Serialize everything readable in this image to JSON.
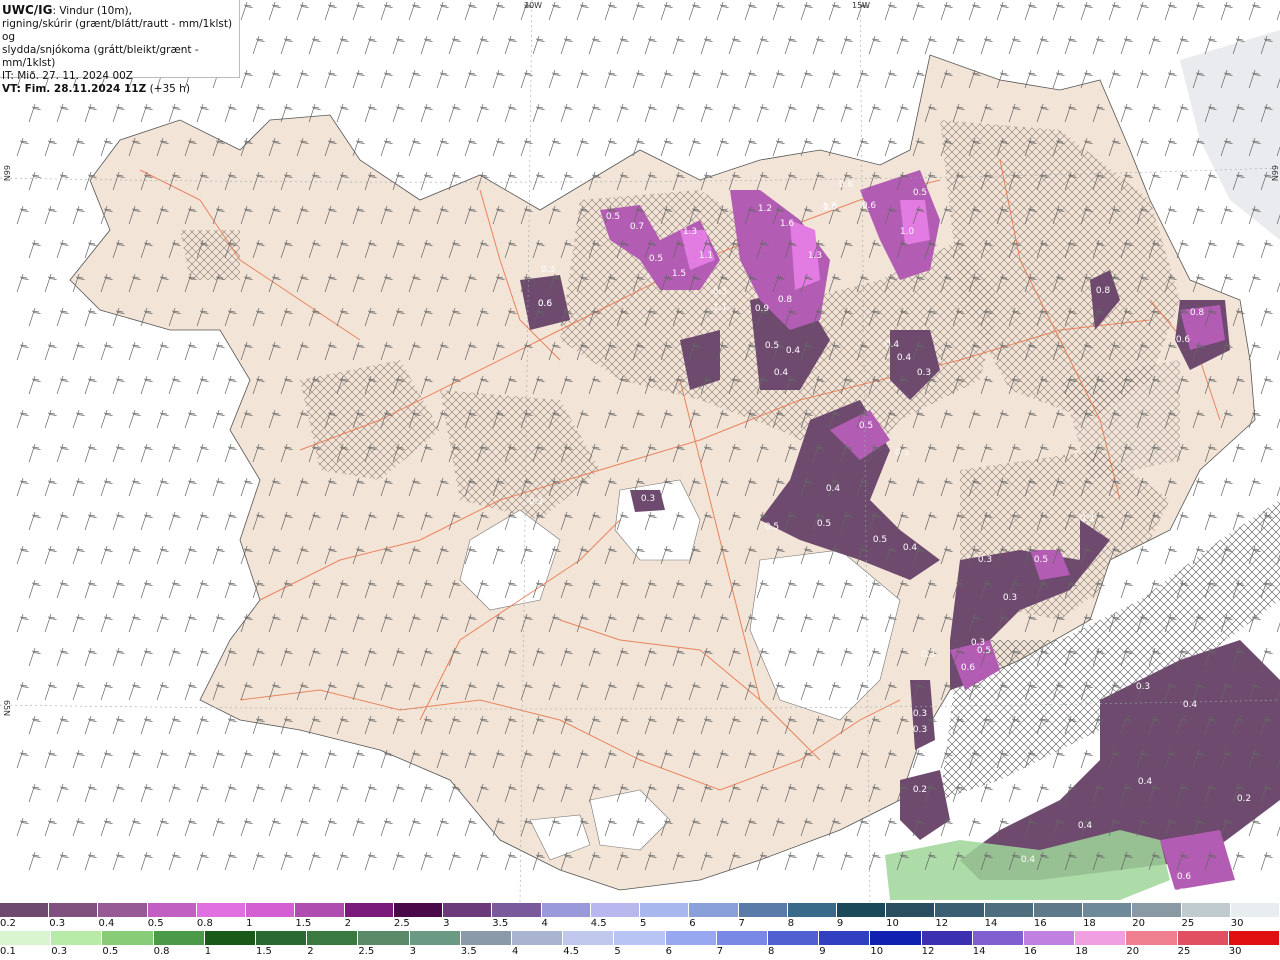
{
  "header": {
    "model": "UWC/IG",
    "line1_rest": ": Vindur (10m),",
    "line2": "rigning/skúrir (grænt/blátt/rautt - mm/1klst) og",
    "line3": "slydda/snjókoma (grátt/bleikt/grænt - mm/1klst)",
    "line4": "IT: Mið. 27. 11. 2024 00Z",
    "line5_bold": "VT: Fim. 28.11.2024 11Z",
    "line5_rest": " (+35 h)"
  },
  "axes": {
    "lon_labels": [
      "20W",
      "15W"
    ],
    "lat_labels": [
      "66N",
      "65N",
      "64N"
    ]
  },
  "map_labels": [
    "0.3",
    "0.6",
    "0.5",
    "0.7",
    "0.5",
    "1.3",
    "1.5",
    "1.1",
    "0.3",
    "1.1",
    "1.2",
    "0.9",
    "1.3",
    "1.6",
    "1.3",
    "0.8",
    "0.9",
    "0.5",
    "0.4",
    "0.4",
    "0.6",
    "0.6",
    "0.6",
    "0.5",
    "1.0",
    "0.4",
    "0.4",
    "0.3",
    "0.8",
    "0.8",
    "0.6",
    "0.5",
    "0.3",
    "0.3",
    "0.3",
    "0.4",
    "0.5",
    "0.5",
    "0.5",
    "0.4",
    "0.3",
    "0.3",
    "0.5",
    "0.3",
    "0.3",
    "0.5",
    "0.6",
    "0.3",
    "0.3",
    "0.3",
    "0.2",
    "0.2",
    "0.3",
    "0.4",
    "0.4",
    "0.2",
    "0.4",
    "0.4",
    "0.4",
    "0.6",
    "0.5",
    "0.6"
  ],
  "legend": {
    "snow_labels": [
      "0.2",
      "0.3",
      "0.4",
      "0.5",
      "0.8",
      "1",
      "1.5",
      "2",
      "2.5",
      "3",
      "3.5",
      "4",
      "4.5",
      "5",
      "6",
      "7",
      "8",
      "9",
      "10",
      "12",
      "14",
      "16",
      "18",
      "20",
      "25",
      "30"
    ],
    "snow_colors": [
      "#6e4a6e",
      "#80507f",
      "#975a97",
      "#c25fc2",
      "#e070e0",
      "#d35fd3",
      "#b04db0",
      "#7a1a7a",
      "#4a0a4a",
      "#6a3a7a",
      "#7a5a9a",
      "#9a9ada",
      "#b8b8ee",
      "#a8b8ee",
      "#8aa0d8",
      "#5a7aa8",
      "#3a6a8a",
      "#1a4a5a",
      "#284e60",
      "#3a5e72",
      "#4e6e80",
      "#5e7a8a",
      "#6e8a98",
      "#8a9aa4",
      "#c0cbd0",
      "#e8eef0"
    ],
    "rain_labels": [
      "0.1",
      "0.3",
      "0.5",
      "0.8",
      "1",
      "1.5",
      "2",
      "2.5",
      "3",
      "3.5",
      "4",
      "4.5",
      "5",
      "6",
      "7",
      "8",
      "9",
      "10",
      "12",
      "14",
      "16",
      "18",
      "20",
      "25",
      "30"
    ],
    "rain_colors": [
      "#d8f5d0",
      "#b8eaa8",
      "#88cc78",
      "#4a9a48",
      "#1a5a18",
      "#2a6a30",
      "#3a7a40",
      "#5a8a68",
      "#6a9a84",
      "#8a9aa8",
      "#a8b4d0",
      "#c0c8ee",
      "#b8c4f4",
      "#98a8f0",
      "#7888e4",
      "#5060d0",
      "#3040c0",
      "#1020b0",
      "#3a30b0",
      "#8060d0",
      "#c080e0",
      "#f0a0e0",
      "#f08090",
      "#e05060",
      "#e01010"
    ]
  },
  "colors": {
    "land": "#f2e4d6",
    "roads": "#e8734a",
    "ice": "#ffffff",
    "sea": "#ffffff",
    "precip_light": "#6e4a6e",
    "precip_mid": "#b35cb3",
    "precip_high": "#e27be2",
    "rain_green": "#9fd69a"
  }
}
